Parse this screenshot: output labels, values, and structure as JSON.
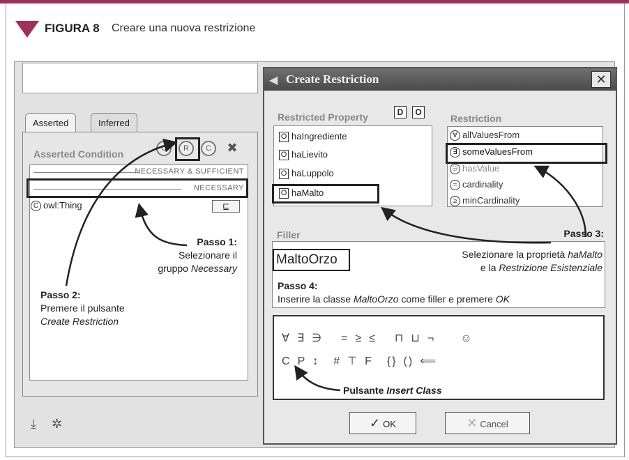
{
  "figure": {
    "label": "FIGURA 8",
    "caption": "Creare una nuova restrizione"
  },
  "colors": {
    "accent": "#a0305a",
    "dialog_title_bg": "#4a4a4a"
  },
  "left_panel": {
    "tabs": [
      "Asserted",
      "Inferred"
    ],
    "conditions_title": "Asserted Condition",
    "toolbar_icons": [
      "create-class-icon",
      "create-restriction-icon",
      "add-named-class-icon",
      "delete-icon"
    ],
    "groups": [
      "NECESSARY & SUFFICIENT",
      "NECESSARY"
    ],
    "row": {
      "class_name": "owl:Thing",
      "subset_symbol": "⊑"
    },
    "bottom_icons": [
      "import-icon",
      "settings-icon"
    ]
  },
  "annotations": {
    "step1": {
      "title": "Passo 1:",
      "line1": "Selezionare il",
      "line2_prefix": "gruppo ",
      "line2_emph": "Necessary"
    },
    "step2": {
      "title": "Passo 2:",
      "line1": "Premere il pulsante",
      "line2": "Create Restriction"
    },
    "step3": {
      "title": "Passo 3:",
      "line1_prefix": "Selezionare la proprietà ",
      "line1_emph": "haMalto",
      "line2_prefix": "e la ",
      "line2_emph": "Restrizione Esistenziale"
    },
    "step4": {
      "title": "Passo 4:",
      "prefix": "Inserire la classe ",
      "emph1": "MaltoOrzo",
      "middle": " come filler e premere ",
      "emph2": "OK"
    },
    "insert_class": {
      "prefix": "Pulsante ",
      "emph": "Insert Class"
    }
  },
  "dialog": {
    "title": "Create Restriction",
    "restricted_property_label": "Restricted Property",
    "property_icons": [
      "D",
      "O"
    ],
    "properties": [
      "haIngrediente",
      "haLievito",
      "haLuppolo",
      "haMalto"
    ],
    "restriction_label": "Restriction",
    "restrictions": [
      {
        "symbol": "∀",
        "name": "allValuesFrom"
      },
      {
        "symbol": "∃",
        "name": "someValuesFrom"
      },
      {
        "symbol": "∋",
        "name": "hasValue"
      },
      {
        "symbol": "=",
        "name": "cardinality"
      },
      {
        "symbol": "≥",
        "name": "minCardinality"
      }
    ],
    "filler_label": "Filler",
    "filler_value": "MaltoOrzo",
    "symbols_row1": [
      "∀",
      "∃",
      "∋",
      "=",
      "≥",
      "≤",
      "⊓",
      "⊔",
      "¬"
    ],
    "symbols_row2": [
      "C",
      "P",
      "↕",
      "#",
      "⊤",
      "F",
      "{}",
      "()",
      "⟸"
    ],
    "ok_label": "OK",
    "cancel_label": "Cancel"
  }
}
